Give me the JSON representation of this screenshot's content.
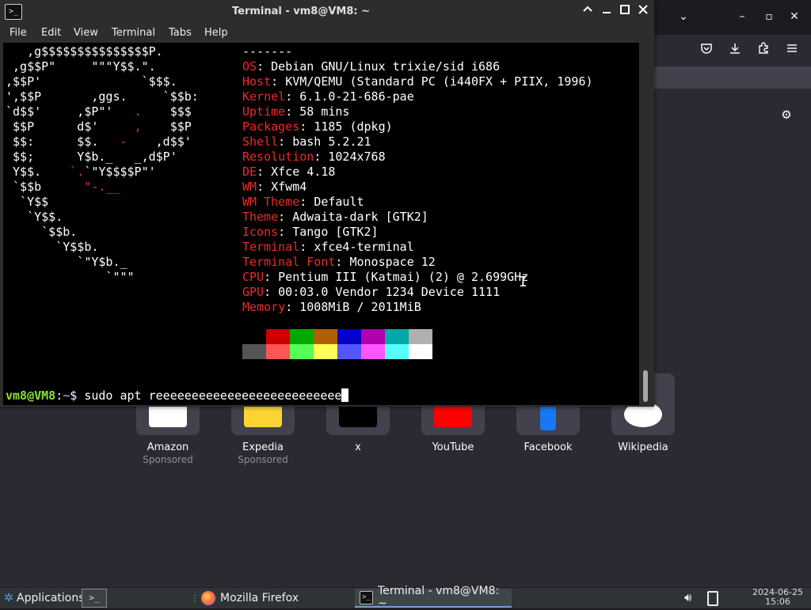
{
  "firefox": {
    "window_controls": {
      "list_all_tabs": "⌄",
      "minimize": "–",
      "maximize": "▫",
      "close": "✕"
    },
    "toolbar_icons": [
      "pocket-icon",
      "downloads-icon",
      "extensions-icon",
      "menu-icon"
    ],
    "settings_icon": "⚙",
    "shortcuts": [
      {
        "name": "Amazon",
        "sub": "Sponsored",
        "logo_color": "#ffffff"
      },
      {
        "name": "Expedia",
        "sub": "Sponsored",
        "logo_color": "#fcd535"
      },
      {
        "name": "x",
        "sub": "",
        "logo_color": "#000000"
      },
      {
        "name": "YouTube",
        "sub": "",
        "logo_color": "#ff0000"
      },
      {
        "name": "Facebook",
        "sub": "",
        "logo_color": "#1877f2"
      },
      {
        "name": "Wikipedia",
        "sub": "",
        "logo_color": "#ffffff"
      }
    ]
  },
  "terminal": {
    "title": "Terminal - vm8@VM8: ~",
    "menu": [
      "File",
      "Edit",
      "View",
      "Terminal",
      "Tabs",
      "Help"
    ],
    "separator": "-------",
    "info": [
      {
        "key": "OS",
        "value": "Debian GNU/Linux trixie/sid i686"
      },
      {
        "key": "Host",
        "value": "KVM/QEMU (Standard PC (i440FX + PIIX, 1996)"
      },
      {
        "key": "Kernel",
        "value": "6.1.0-21-686-pae"
      },
      {
        "key": "Uptime",
        "value": "58 mins"
      },
      {
        "key": "Packages",
        "value": "1185 (dpkg)"
      },
      {
        "key": "Shell",
        "value": "bash 5.2.21"
      },
      {
        "key": "Resolution",
        "value": "1024x768"
      },
      {
        "key": "DE",
        "value": "Xfce 4.18"
      },
      {
        "key": "WM",
        "value": "Xfwm4"
      },
      {
        "key": "WM Theme",
        "value": "Default"
      },
      {
        "key": "Theme",
        "value": "Adwaita-dark [GTK2]"
      },
      {
        "key": "Icons",
        "value": "Tango [GTK2]"
      },
      {
        "key": "Terminal",
        "value": "xfce4-terminal"
      },
      {
        "key": "Terminal Font",
        "value": "Monospace 12"
      },
      {
        "key": "CPU",
        "value": "Pentium III (Katmai) (2) @ 2.699GHz"
      },
      {
        "key": "GPU",
        "value": "00:03.0 Vendor 1234 Device 1111"
      },
      {
        "key": "Memory",
        "value": "1008MiB / 2011MiB"
      }
    ],
    "palette": {
      "row1": [
        "#000000",
        "#cc0000",
        "#00a900",
        "#b06000",
        "#0000c8",
        "#b000b0",
        "#00a8a8",
        "#b0b0b0"
      ],
      "row2": [
        "#555555",
        "#ff5555",
        "#55ff55",
        "#ffff55",
        "#5555ff",
        "#ff55ff",
        "#55ffff",
        "#ffffff"
      ]
    },
    "prompt": {
      "user": "vm8@VM8",
      "sep": ":",
      "path": "~",
      "symbol": "$",
      "command": " sudo apt reeeeeeeeeeeeeeeeeeeeeeeeee"
    }
  },
  "taskbar": {
    "applications": "Applications",
    "tasks": [
      {
        "label": "Mozilla Firefox",
        "active": false
      },
      {
        "label": "Terminal - vm8@VM8: ~",
        "active": true
      }
    ],
    "clock": {
      "date": "2024-06-25",
      "time": "15:06"
    }
  }
}
